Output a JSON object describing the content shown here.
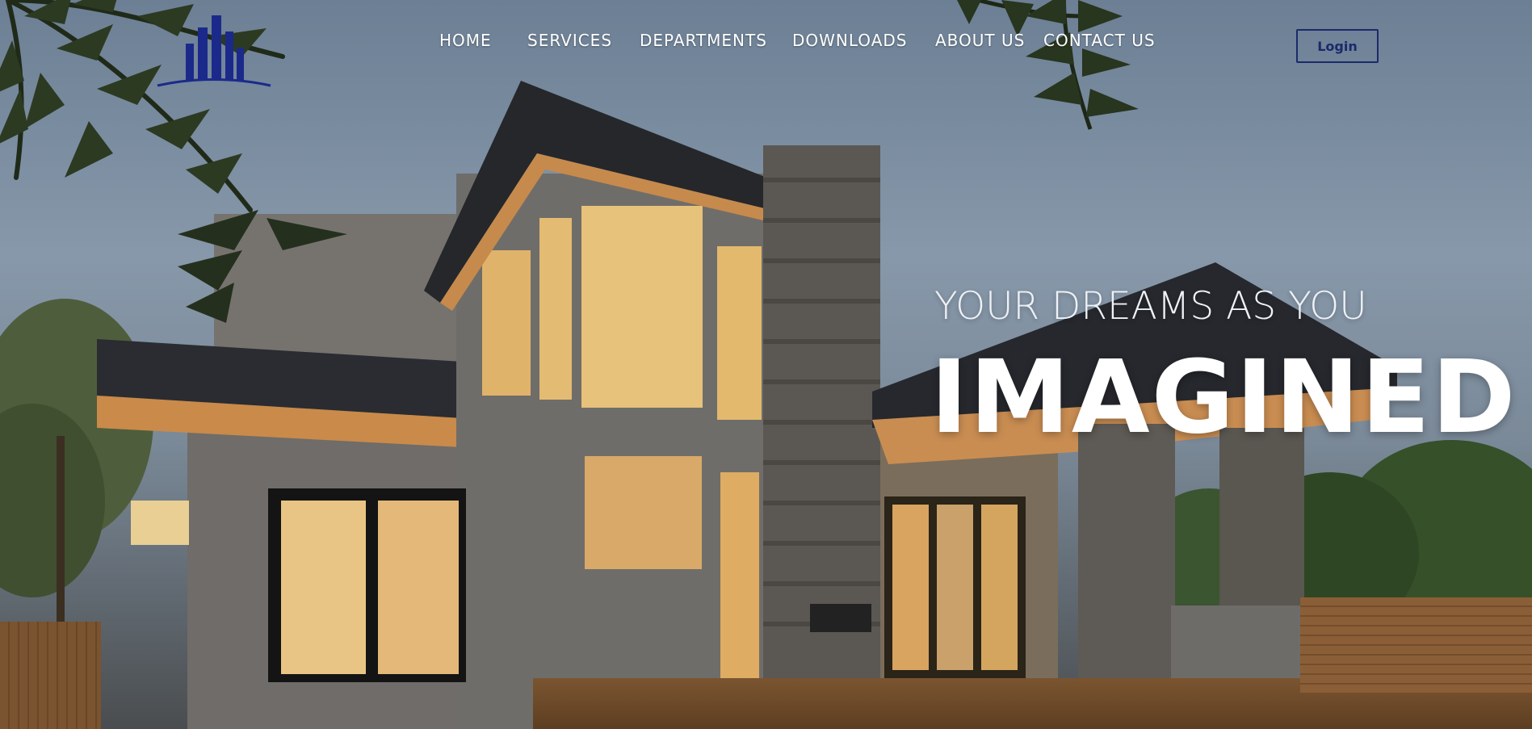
{
  "nav": {
    "items": [
      {
        "label": "HOME"
      },
      {
        "label": "SERVICES"
      },
      {
        "label": "DEPARTMENTS"
      },
      {
        "label": "DOWNLOADS"
      },
      {
        "label": "ABOUT US"
      },
      {
        "label": "CONTACT US"
      }
    ],
    "login_label": "Login"
  },
  "hero": {
    "subtitle": "YOUR DREAMS AS YOU",
    "title": "IMAGINED"
  },
  "logo": {
    "icon": "building-skyline-logo-icon"
  },
  "colors": {
    "nav_text": "#ffffff",
    "login_accent": "#1b2a6b",
    "logo": "#1b2a8a"
  }
}
